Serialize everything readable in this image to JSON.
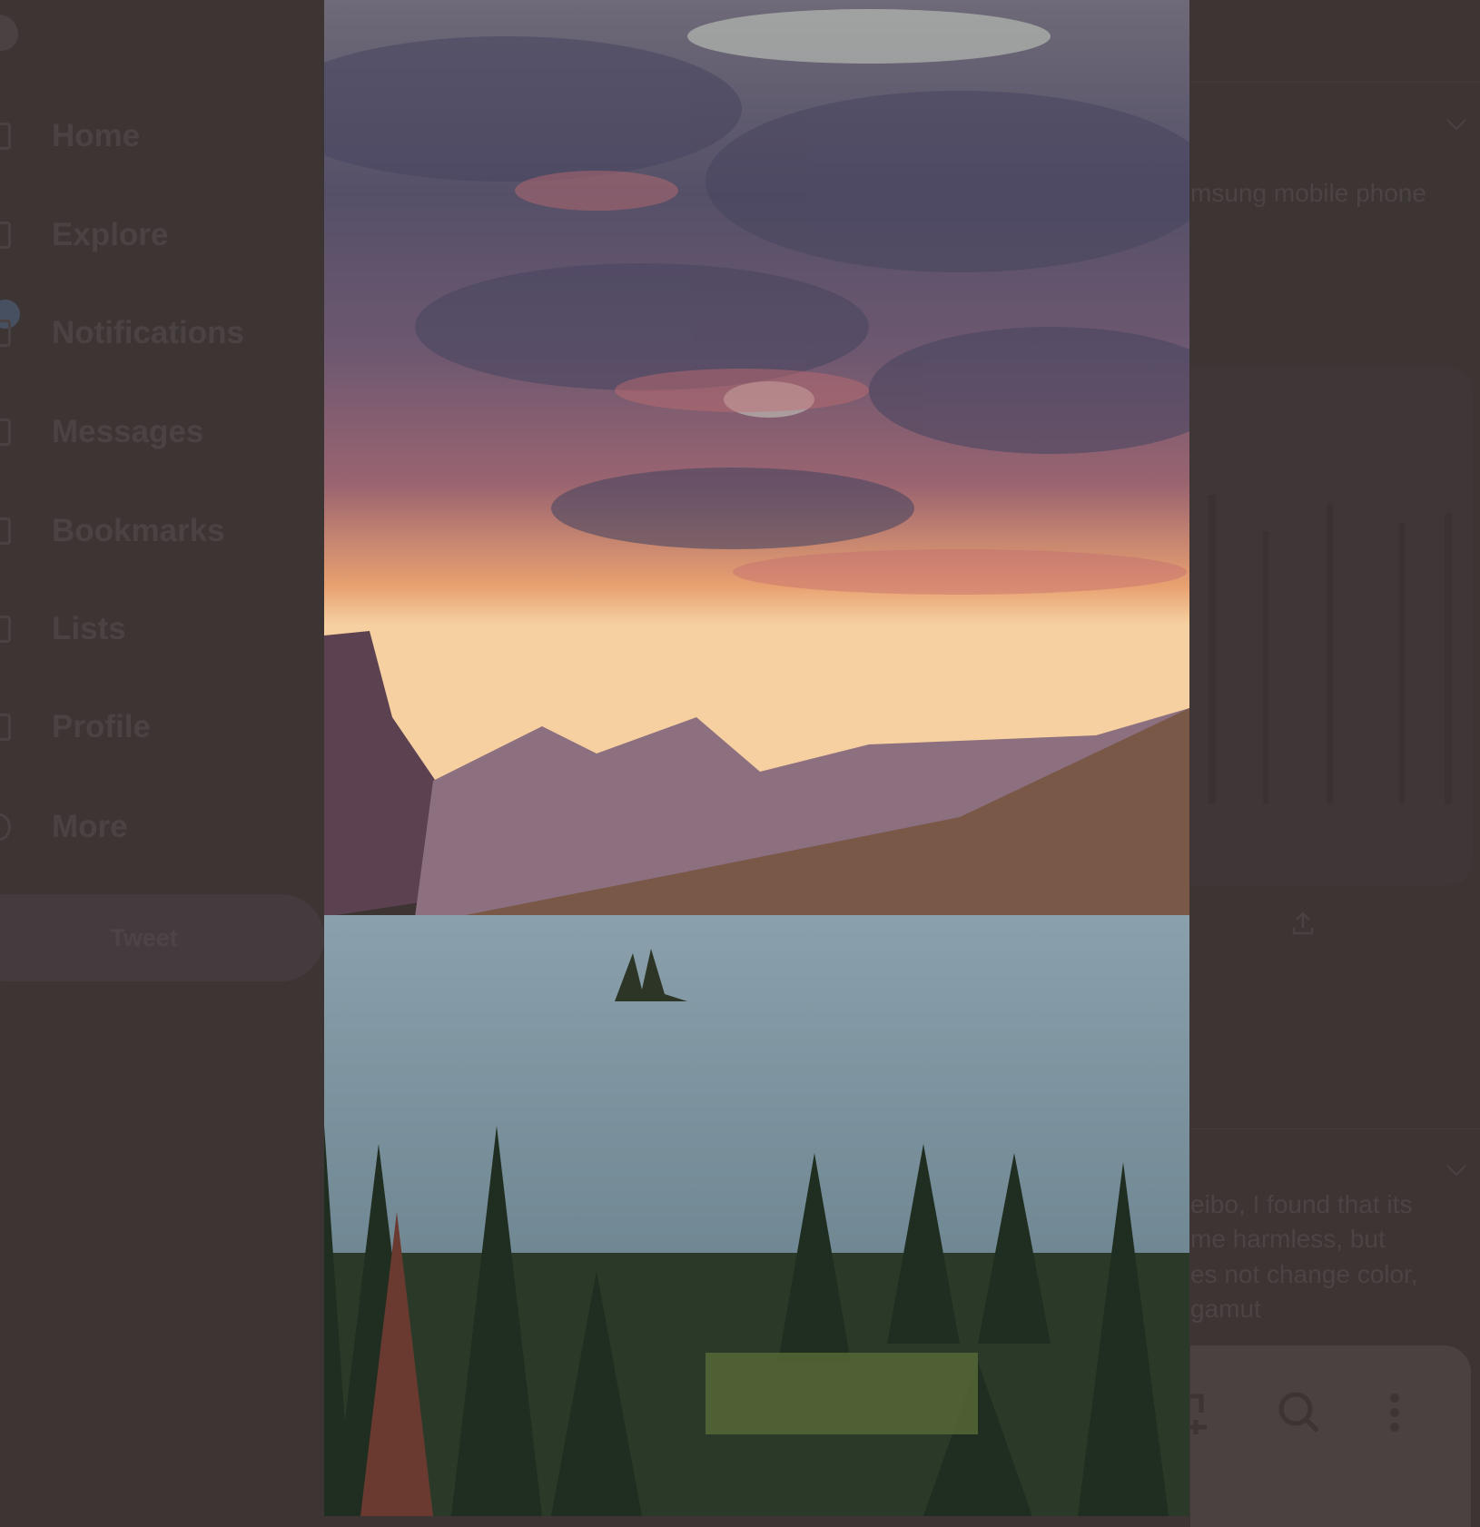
{
  "sidebar": {
    "logo": "twitter-bird-icon",
    "items": [
      {
        "label": "Home",
        "icon": "home-icon"
      },
      {
        "label": "Explore",
        "icon": "hashtag-icon"
      },
      {
        "label": "Notifications",
        "icon": "bell-icon"
      },
      {
        "label": "Messages",
        "icon": "envelope-icon"
      },
      {
        "label": "Bookmarks",
        "icon": "bookmark-icon"
      },
      {
        "label": "Lists",
        "icon": "list-icon"
      },
      {
        "label": "Profile",
        "icon": "person-icon"
      },
      {
        "label": "More",
        "icon": "more-circle-icon"
      }
    ],
    "tweet_label": "Tweet"
  },
  "right": {
    "tweet1_text": "msung mobile phone",
    "tweet2_lines": [
      "eibo, I found that its",
      "me harmless, but",
      "es not change color,",
      "gamut"
    ]
  },
  "colors": {
    "overlay_background": "#3d3434"
  }
}
